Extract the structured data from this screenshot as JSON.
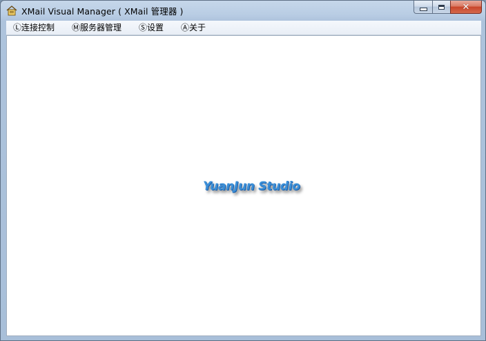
{
  "window": {
    "title": "XMail Visual Manager ( XMail 管理器 )",
    "icon": "home-folder-icon",
    "caption_buttons": {
      "minimize_icon": "minimize-icon",
      "maximize_icon": "maximize-icon",
      "close_icon": "close-icon",
      "close_glyph": "✕"
    },
    "close_color": "#c8452a"
  },
  "menubar": {
    "items": [
      {
        "label": "Ⓛ连接控制"
      },
      {
        "label": "Ⓜ服务器管理"
      },
      {
        "label": "Ⓢ设置"
      },
      {
        "label": "Ⓐ关于"
      }
    ]
  },
  "client": {
    "logo_text": "YuanJun Studio",
    "background": "#ffffff",
    "logo_color": "#3b8fd8"
  }
}
